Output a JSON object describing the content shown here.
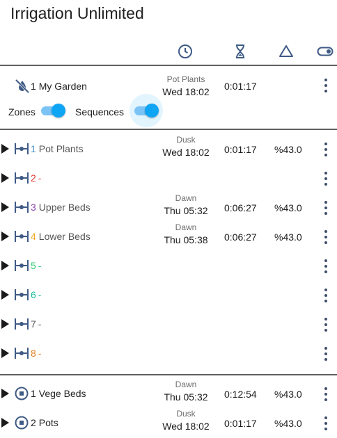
{
  "app": {
    "title": "Irrigation Unlimited"
  },
  "header": {
    "icons": [
      "clock-icon",
      "hourglass-icon",
      "triangle-delta-icon",
      "toggle-icon"
    ]
  },
  "controller": {
    "number": "1",
    "name": "My Garden",
    "schedule_label": "Pot Plants",
    "schedule_time": "Wed 18:02",
    "duration": "0:01:17",
    "zones_label": "Zones",
    "sequences_label": "Sequences",
    "zones_enabled": true,
    "sequences_enabled": true
  },
  "zones": [
    {
      "num": "1",
      "name": "Pot Plants",
      "num_color": "#4a90c8",
      "schedule_label": "Dusk",
      "schedule_time": "Wed 18:02",
      "duration": "0:01:17",
      "adjust": "%43.0"
    },
    {
      "num": "2",
      "name": "-",
      "num_color": "#e53935",
      "schedule_label": "",
      "schedule_time": "",
      "duration": "",
      "adjust": ""
    },
    {
      "num": "3",
      "name": "Upper Beds",
      "num_color": "#8e44ad",
      "schedule_label": "Dawn",
      "schedule_time": "Thu 05:32",
      "duration": "0:06:27",
      "adjust": "%43.0"
    },
    {
      "num": "4",
      "name": "Lower Beds",
      "num_color": "#f5a623",
      "schedule_label": "Dawn",
      "schedule_time": "Thu 05:38",
      "duration": "0:06:27",
      "adjust": "%43.0"
    },
    {
      "num": "5",
      "name": "-",
      "num_color": "#2ecc71",
      "schedule_label": "",
      "schedule_time": "",
      "duration": "",
      "adjust": ""
    },
    {
      "num": "6",
      "name": "-",
      "num_color": "#1abc9c",
      "schedule_label": "",
      "schedule_time": "",
      "duration": "",
      "adjust": ""
    },
    {
      "num": "7",
      "name": "-",
      "num_color": "#555555",
      "schedule_label": "",
      "schedule_time": "",
      "duration": "",
      "adjust": ""
    },
    {
      "num": "8",
      "name": "-",
      "num_color": "#e67e22",
      "schedule_label": "",
      "schedule_time": "",
      "duration": "",
      "adjust": ""
    }
  ],
  "sequences": [
    {
      "num": "1",
      "name": "Vege Beds",
      "schedule_label": "Dawn",
      "schedule_time": "Thu 05:32",
      "duration": "0:12:54",
      "adjust": "%43.0"
    },
    {
      "num": "2",
      "name": "Pots",
      "schedule_label": "Dusk",
      "schedule_time": "Wed 18:02",
      "duration": "0:01:17",
      "adjust": "%43.0"
    }
  ],
  "colors": {
    "accent": "#0ea5f4",
    "icon": "#3e5a85"
  }
}
